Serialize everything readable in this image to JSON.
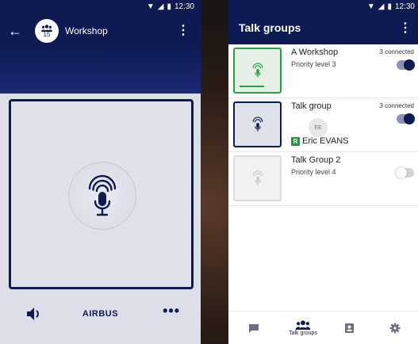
{
  "left": {
    "status": {
      "time": "12:30"
    },
    "header": {
      "title": "Workshop",
      "member_count": "15"
    },
    "footer": {
      "brand": "AIRBUS"
    }
  },
  "right": {
    "status": {
      "time": "12:30"
    },
    "header": {
      "title": "Talk groups"
    },
    "groups": [
      {
        "name": "A Workshop",
        "priority": "Priority level 3",
        "connected": "3 connected",
        "enabled": true,
        "state": "active"
      },
      {
        "name": "Talk group",
        "priority": "",
        "connected": "3 connected",
        "enabled": true,
        "state": "selected",
        "initials": "EE",
        "speaker_badge": "R",
        "speaker": "Eric EVANS"
      },
      {
        "name": "Talk Group 2",
        "priority": "Priority level 4",
        "connected": "",
        "enabled": false,
        "state": "idle"
      }
    ],
    "nav": {
      "talk_groups_label": "Talk groups"
    }
  },
  "colors": {
    "primary": "#0e1a52",
    "active": "#27a53d",
    "badge": "#1e9a36"
  },
  "icons": [
    "arrow-back-icon",
    "group-icon",
    "more-vert-icon",
    "microphone-icon",
    "volume-icon",
    "more-horiz-icon",
    "chat-icon",
    "contacts-icon",
    "settings-icon",
    "wifi-icon",
    "signal-icon",
    "battery-icon"
  ]
}
